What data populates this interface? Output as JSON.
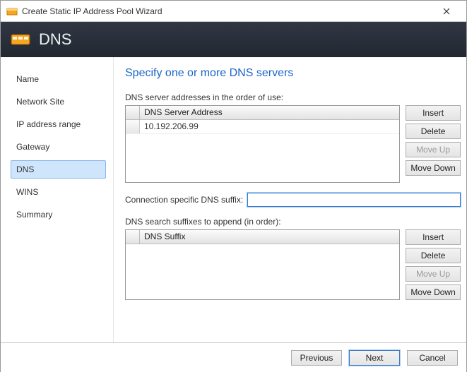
{
  "window": {
    "title": "Create Static IP Address Pool Wizard"
  },
  "header": {
    "title": "DNS"
  },
  "sidebar": {
    "items": [
      {
        "label": "Name"
      },
      {
        "label": "Network Site"
      },
      {
        "label": "IP address range"
      },
      {
        "label": "Gateway"
      },
      {
        "label": "DNS",
        "selected": true
      },
      {
        "label": "WINS"
      },
      {
        "label": "Summary"
      }
    ]
  },
  "content": {
    "title": "Specify one or more DNS servers",
    "servers_label": "DNS server addresses in the order of use:",
    "servers_col": "DNS Server Address",
    "server_rows": [
      "10.192.206.99"
    ],
    "suffix_label": "Connection specific DNS suffix:",
    "suffix_value": "",
    "search_label": "DNS search suffixes to append (in order):",
    "search_col": "DNS Suffix",
    "search_rows": []
  },
  "buttons": {
    "insert": "Insert",
    "delete": "Delete",
    "moveup": "Move Up",
    "movedown": "Move Down"
  },
  "footer": {
    "previous": "Previous",
    "next": "Next",
    "cancel": "Cancel"
  }
}
